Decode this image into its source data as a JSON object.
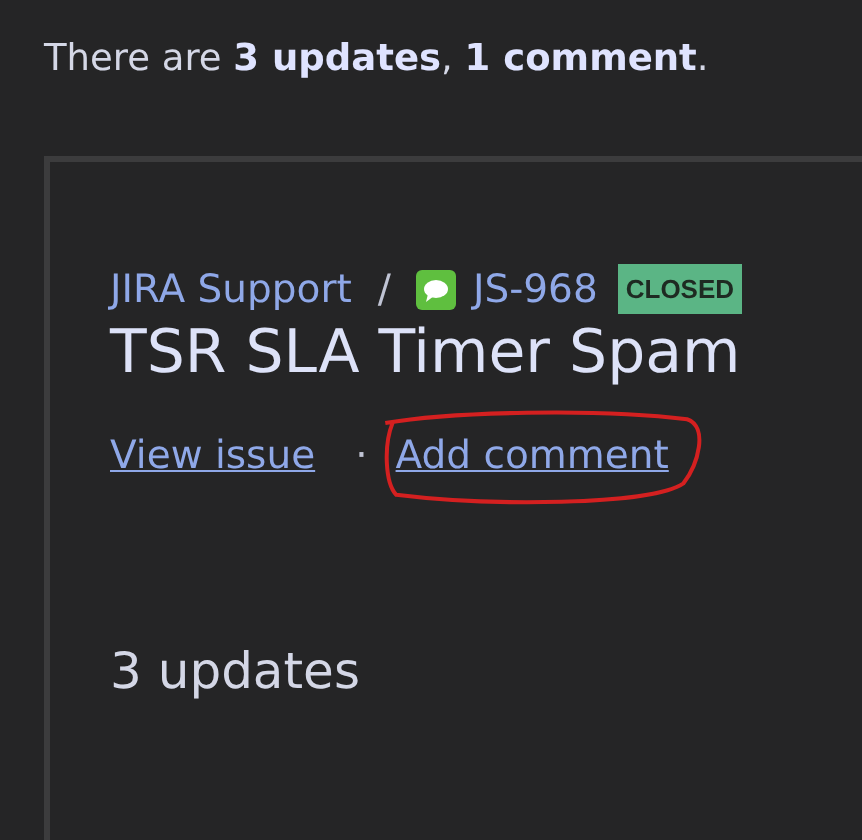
{
  "summary": "There are **3 updates**, **1 comment**.",
  "issue": {
    "project": "JIRA Support",
    "separator": "/",
    "key": "JS-968",
    "status": "CLOSED",
    "title": "TSR SLA Timer Spam"
  },
  "links": [
    {
      "label": "View issue",
      "annotated": false
    },
    {
      "label": "Add comment",
      "annotated": true
    }
  ],
  "link_separator": "·",
  "updates_heading": "3 updates"
}
